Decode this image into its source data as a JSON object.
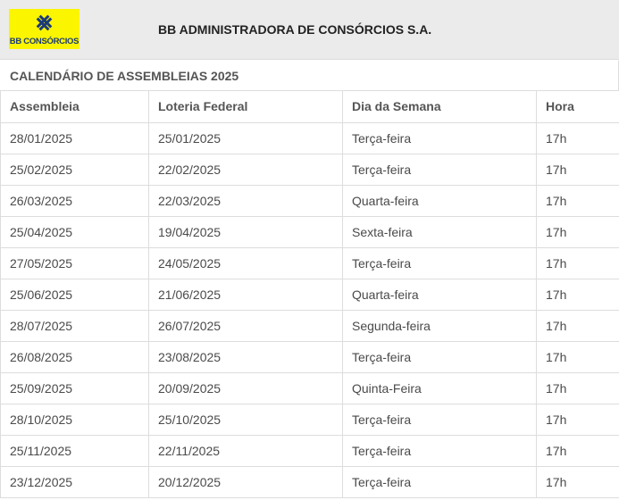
{
  "header": {
    "logo_text": "BB CONSÓRCIOS",
    "company": "BB ADMINISTRADORA DE CONSÓRCIOS S.A."
  },
  "section_title": "CALENDÁRIO DE ASSEMBLEIAS 2025",
  "table": {
    "columns": [
      "Assembleia",
      "Loteria Federal",
      "Dia da Semana",
      "Hora"
    ],
    "rows": [
      [
        "28/01/2025",
        "25/01/2025",
        "Terça-feira",
        "17h"
      ],
      [
        "25/02/2025",
        "22/02/2025",
        "Terça-feira",
        "17h"
      ],
      [
        "26/03/2025",
        "22/03/2025",
        "Quarta-feira",
        "17h"
      ],
      [
        "25/04/2025",
        "19/04/2025",
        "Sexta-feira",
        "17h"
      ],
      [
        "27/05/2025",
        "24/05/2025",
        "Terça-feira",
        "17h"
      ],
      [
        "25/06/2025",
        "21/06/2025",
        "Quarta-feira",
        "17h"
      ],
      [
        "28/07/2025",
        "26/07/2025",
        "Segunda-feira",
        "17h"
      ],
      [
        "26/08/2025",
        "23/08/2025",
        "Terça-feira",
        "17h"
      ],
      [
        "25/09/2025",
        "20/09/2025",
        "Quinta-Feira",
        "17h"
      ],
      [
        "28/10/2025",
        "25/10/2025",
        "Terça-feira",
        "17h"
      ],
      [
        "25/11/2025",
        "22/11/2025",
        "Terça-feira",
        "17h"
      ],
      [
        "23/12/2025",
        "20/12/2025",
        "Terça-feira",
        "17h"
      ]
    ]
  },
  "colors": {
    "brand_yellow": "#fcf500",
    "brand_blue": "#1a3a7a",
    "header_bg": "#ebebeb"
  }
}
